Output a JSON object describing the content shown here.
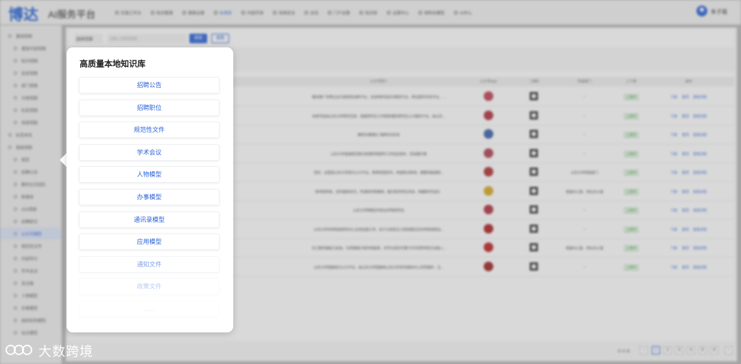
{
  "app": {
    "logo": "博达",
    "subtitle": "AI服务平台",
    "user": "朱子薇"
  },
  "nav": {
    "items": [
      {
        "label": "实施工作台"
      },
      {
        "label": "知识管理"
      },
      {
        "label": "搜索运营"
      },
      {
        "label": "标准库",
        "active": true
      },
      {
        "label": "内容开放"
      },
      {
        "label": "系统安全"
      },
      {
        "label": "总览"
      },
      {
        "label": "门户运营"
      },
      {
        "label": "知识库"
      },
      {
        "label": "运营中心"
      },
      {
        "label": "结构化模型"
      },
      {
        "label": "AI中心"
      }
    ]
  },
  "sidebar": {
    "items": [
      {
        "label": "基础视图",
        "level": "group"
      },
      {
        "label": "重复内容视图",
        "level": "sub"
      },
      {
        "label": "知识视图",
        "level": "sub"
      },
      {
        "label": "信息视图",
        "level": "sub"
      },
      {
        "label": "部门视图",
        "level": "sub"
      },
      {
        "label": "分类视图",
        "level": "sub"
      },
      {
        "label": "标签视图",
        "level": "sub"
      },
      {
        "label": "场景视图",
        "level": "sub"
      },
      {
        "label": "标签体系",
        "level": "group"
      },
      {
        "label": "高级视图",
        "level": "group"
      },
      {
        "label": "规范",
        "level": "sub"
      },
      {
        "label": "招聘公告",
        "level": "sub"
      },
      {
        "label": "教师主页团队",
        "level": "sub"
      },
      {
        "label": "新媒体",
        "level": "sub"
      },
      {
        "label": "GIS视图",
        "level": "sub"
      },
      {
        "label": "招聘职位",
        "level": "sub"
      },
      {
        "label": "公众号模型",
        "level": "sub",
        "active": true
      },
      {
        "label": "规范性文件",
        "level": "sub"
      },
      {
        "label": "内容导引",
        "level": "sub"
      },
      {
        "label": "学术会议",
        "level": "sub"
      },
      {
        "label": "采访报",
        "level": "sub"
      },
      {
        "label": "人物模型",
        "level": "sub"
      },
      {
        "label": "办事模型",
        "level": "sub"
      },
      {
        "label": "组织机构模型",
        "level": "sub"
      },
      {
        "label": "站点模型",
        "level": "sub"
      }
    ]
  },
  "filter": {
    "scope_label": "选择范围",
    "keyword_placeholder": "请输入关键词搜索",
    "search_button": "搜索",
    "reset_button": "重置"
  },
  "table": {
    "columns": [
      "公众号简介",
      "公众号logo",
      "二维码",
      "所属部门",
      "上下架",
      "操作"
    ],
    "rows": [
      {
        "intro": "服务推广优秀企业与高校的创新平台，先进材料测试与制造平台，转化医学共享平台，...",
        "dept": "--",
        "status": "上架中",
        "logo_color": "#c04050"
      },
      {
        "intro": "本账号是由山东大学研究生院、党委研究生工作部管理的研究生公众服务平台，由山东...",
        "dept": "--",
        "status": "上架中",
        "logo_color": "#b03040"
      },
      {
        "intro": "精研法律理论 深耕司法实务",
        "dept": "--",
        "status": "上架中",
        "logo_color": "#3a5fa8"
      },
      {
        "intro": "山东大学威海校区联合管理学院团学工作信息发布、风采展示等",
        "dept": "--",
        "status": "上架中",
        "logo_color": "#b04050"
      },
      {
        "intro": "您好，这里是山东大学官方公众平台，新鲜校园资讯，权威热点新闻，重要讲座通知...",
        "dept": "山东大学校属部门",
        "status": "上架中",
        "logo_color": "#b03030"
      },
      {
        "intro": "新传新阵地，宣传最新资讯，传递新传新精神，展示新传师生风采，唤醒新传活动！",
        "dept": "党委办公室、校长办公室",
        "status": "上架中",
        "logo_color": "#d8a820"
      },
      {
        "intro": "山东大学网络空间安全学院研究生",
        "dept": "--",
        "status": "上架中",
        "logo_color": "#b03040"
      },
      {
        "intro": "山东大学世界政党研究中心主持运营公号，关于马克思主义政党理论及世界政党政治...",
        "dept": "--",
        "status": "上架中",
        "logo_color": "#b02020"
      },
      {
        "intro": "为汇聚青春能力加油，为师德振兴揭开新篇章，本号为爱好开展\"中华优秀传统文化融入...",
        "dept": "党委办公室、校长办公室",
        "status": "上架中",
        "logo_color": "#c02020"
      },
      {
        "intro": "山东大学团委官方公众平台，由山东大学团委和山东大学青年媒体中心共同维护，主...",
        "dept": "--",
        "status": "上架中",
        "logo_color": "#a02020"
      }
    ],
    "actions": [
      "下架",
      "置顶",
      "查看详情"
    ]
  },
  "pagination": {
    "total": "共 50 条",
    "pages": [
      "1",
      "2",
      "3",
      "4",
      "5",
      "6"
    ],
    "current": "1",
    "prev": "‹",
    "next": "›"
  },
  "popup": {
    "title": "高质量本地知识库",
    "items": [
      {
        "label": "招聘公告",
        "style": "normal"
      },
      {
        "label": "招聘职位",
        "style": "normal"
      },
      {
        "label": "规范性文件",
        "style": "normal"
      },
      {
        "label": "学术会议",
        "style": "normal"
      },
      {
        "label": "人物模型",
        "style": "normal"
      },
      {
        "label": "办事模型",
        "style": "normal"
      },
      {
        "label": "通讯录模型",
        "style": "normal"
      },
      {
        "label": "应用模型",
        "style": "normal"
      },
      {
        "label": "通知文件",
        "style": "faded"
      },
      {
        "label": "政策文件",
        "style": "faded2"
      },
      {
        "label": "......",
        "style": "faded3"
      }
    ]
  },
  "watermark": {
    "text": "大数跨境"
  },
  "colors": {
    "accent": "#2a62d8",
    "status_green": "#3a9a3a"
  }
}
